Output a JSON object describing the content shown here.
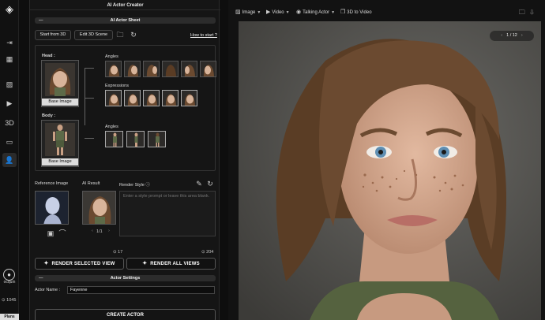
{
  "rail": {
    "user_label": "ocquin",
    "credits": "1045",
    "plan_label": "Plans"
  },
  "panel": {
    "title": "AI Actor Creator",
    "sheet_section": "AI Actor Sheet",
    "start_from_3d": "Start from 3D",
    "edit_3d_scene": "Edit 3D Scene",
    "how_to_start": "How to start ?",
    "head_label": "Head :",
    "body_label": "Body :",
    "angles_label": "Angles",
    "expressions_label": "Expressions",
    "body_angles_label": "Angles",
    "base_image_label": "Base Image",
    "body_base_image_label": "Base Image",
    "reference_image_label": "Reference Image",
    "ai_result_label": "AI Result",
    "render_style_label": "Render Style",
    "render_style_placeholder": "Enter a style prompt or leave this area blank.",
    "result_pager": "1/1",
    "selected_cost": "17",
    "all_cost": "204",
    "render_selected": "RENDER SELECTED VIEW",
    "render_all": "RENDER ALL VIEWS",
    "settings_section": "Actor Settings",
    "actor_name_label": "Actor Name :",
    "actor_name_value": "Fayenne",
    "create_actor": "CREATE ACTOR"
  },
  "viewer": {
    "tabs": [
      {
        "label": "Image",
        "icon": "image-icon"
      },
      {
        "label": "Video",
        "icon": "video-icon"
      },
      {
        "label": "Talking Actor",
        "icon": "talking-actor-icon"
      },
      {
        "label": "3D to Video",
        "icon": "cube-icon"
      }
    ],
    "pager": "1 / 12"
  }
}
